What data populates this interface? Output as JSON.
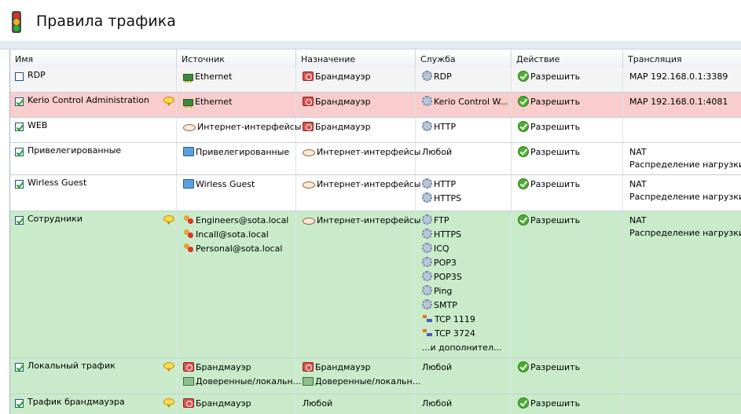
{
  "window": {
    "title": "Правила трафика"
  },
  "columns": [
    "Имя",
    "Источник",
    "Назначение",
    "Служба",
    "Действие",
    "Трансляция"
  ],
  "colors": {
    "row_red": "#f9cdcd",
    "row_green": "#c9ebc9",
    "row_white": "#ffffff",
    "row_selected": "#f4f4f4"
  },
  "rules": [
    {
      "name": "RDP",
      "checked": false,
      "comment": false,
      "bg": "row_selected",
      "source": [
        {
          "icon": "ethernet-icon",
          "text": "Ethernet"
        }
      ],
      "dest": [
        {
          "icon": "firewall-icon",
          "text": "Брандмауэр"
        }
      ],
      "service": [
        {
          "icon": "service-gear-icon",
          "text": "RDP"
        }
      ],
      "action": "Разрешить",
      "translation": [
        "MAP 192.168.0.1:3389"
      ]
    },
    {
      "name": "Kerio Control Administration",
      "checked": true,
      "comment": true,
      "bg": "row_red",
      "source": [
        {
          "icon": "ethernet-icon",
          "text": "Ethernet"
        }
      ],
      "dest": [
        {
          "icon": "firewall-icon",
          "text": "Брандмауэр"
        }
      ],
      "service": [
        {
          "icon": "service-gear-icon",
          "text": "Kerio Control W..."
        }
      ],
      "action": "Разрешить",
      "translation": [
        "MAP 192.168.0.1:4081"
      ]
    },
    {
      "name": "WEB",
      "checked": true,
      "comment": false,
      "bg": "row_white",
      "source": [
        {
          "icon": "internet-interfaces-icon",
          "text": "Интернет-интерфейсы"
        }
      ],
      "dest": [
        {
          "icon": "firewall-icon",
          "text": "Брандмауэр"
        }
      ],
      "service": [
        {
          "icon": "service-gear-icon",
          "text": "HTTP"
        }
      ],
      "action": "Разрешить",
      "translation": []
    },
    {
      "name": "Привелегированные",
      "checked": true,
      "comment": false,
      "bg": "row_white",
      "source": [
        {
          "icon": "host-group-icon",
          "text": "Привелегированные"
        }
      ],
      "dest": [
        {
          "icon": "internet-interfaces-icon",
          "text": "Интернет-интерфейсы"
        }
      ],
      "service": [
        {
          "icon": "",
          "text": "Любой"
        }
      ],
      "action": "Разрешить",
      "translation": [
        "NAT",
        "Распределение нагрузки..."
      ]
    },
    {
      "name": "Wirless Guest",
      "checked": true,
      "comment": false,
      "bg": "row_white",
      "source": [
        {
          "icon": "host-group-icon",
          "text": "Wirless Guest"
        }
      ],
      "dest": [
        {
          "icon": "internet-interfaces-icon",
          "text": "Интернет-интерфейсы"
        }
      ],
      "service": [
        {
          "icon": "service-gear-icon",
          "text": "HTTP"
        },
        {
          "icon": "service-gear-icon",
          "text": "HTTPS"
        }
      ],
      "action": "Разрешить",
      "translation": [
        "NAT",
        "Распределение нагрузки..."
      ]
    },
    {
      "name": "Сотрудники",
      "checked": true,
      "comment": true,
      "bg": "row_green",
      "source": [
        {
          "icon": "user-group-icon",
          "text": "Engineers@sota.local"
        },
        {
          "icon": "user-group-icon",
          "text": "Incall@sota.local"
        },
        {
          "icon": "user-group-icon",
          "text": "Personal@sota.local"
        }
      ],
      "dest": [
        {
          "icon": "internet-interfaces-icon",
          "text": "Интернет-интерфейсы"
        }
      ],
      "service": [
        {
          "icon": "service-gear-icon",
          "text": "FTP"
        },
        {
          "icon": "service-gear-icon",
          "text": "HTTPS"
        },
        {
          "icon": "service-gear-icon",
          "text": "ICQ"
        },
        {
          "icon": "service-gear-icon",
          "text": "POP3"
        },
        {
          "icon": "service-gear-icon",
          "text": "POP3S"
        },
        {
          "icon": "service-gear-icon",
          "text": "Ping"
        },
        {
          "icon": "service-gear-icon",
          "text": "SMTP"
        },
        {
          "icon": "tcp-port-icon",
          "text": "TCP 1119"
        },
        {
          "icon": "tcp-port-icon",
          "text": "TCP 3724"
        },
        {
          "icon": "",
          "text": "...и дополнител..."
        }
      ],
      "action": "Разрешить",
      "translation": [
        "NAT",
        "Распределение нагрузки..."
      ]
    },
    {
      "name": "Локальный трафик",
      "checked": true,
      "comment": true,
      "bg": "row_green",
      "source": [
        {
          "icon": "firewall-icon",
          "text": "Брандмауэр"
        },
        {
          "icon": "trusted-local-icon",
          "text": "Доверенные/локальн..."
        }
      ],
      "dest": [
        {
          "icon": "firewall-icon",
          "text": "Брандмауэр"
        },
        {
          "icon": "trusted-local-icon",
          "text": "Доверенные/локальн..."
        }
      ],
      "service": [
        {
          "icon": "",
          "text": "Любой"
        }
      ],
      "action": "Разрешить",
      "translation": []
    },
    {
      "name": "Трафик брандмауэра",
      "checked": true,
      "comment": true,
      "bg": "row_green",
      "source": [
        {
          "icon": "firewall-icon",
          "text": "Брандмауэр"
        }
      ],
      "dest": [
        {
          "icon": "",
          "text": "Любой"
        }
      ],
      "service": [
        {
          "icon": "",
          "text": "Любой"
        }
      ],
      "action": "Разрешить",
      "translation": []
    }
  ]
}
